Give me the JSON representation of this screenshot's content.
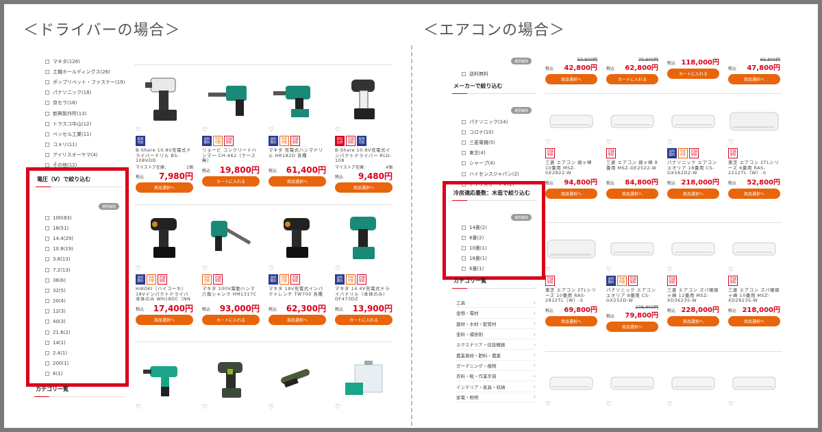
{
  "left": {
    "heading": "＜ドライバーの場合＞",
    "makers": [
      "マキタ(126)",
      "工機ホールディングス(26)",
      "ポップリベット・ファスナー(19)",
      "パナソニック(18)",
      "京セラ(18)",
      "新興製作所(13)",
      "トラスコ中山(12)",
      "ベッセル工業(11)",
      "コメリ(11)",
      "アイリスオーヤマ(4)",
      "その他(12)"
    ],
    "voltage_title": "電圧（V）で絞り込む",
    "clear_label": "選択解除",
    "voltages": [
      "100(83)",
      "18(51)",
      "14.4(29)",
      "10.8(19)",
      "3.6(13)",
      "7.2(13)",
      "36(6)",
      "32(5)",
      "20(4)",
      "12(3)",
      "40(3)",
      "21.6(2)",
      "14(1)",
      "2.4(1)",
      "200(1)",
      "6(1)"
    ],
    "category_title": "カテゴリ一覧",
    "products_row1": [
      {
        "name": "B-Share 10.8V充電式ドライバードリル BS-108VDD",
        "badges": [
          [
            "取寄",
            "可能",
            "blue"
          ]
        ],
        "note": "マイストア在庫：",
        "stock": "1個",
        "tax": "税込",
        "price": "7,980円",
        "button": "商品選択へ"
      },
      {
        "name": "リョービ コンクリートハンマー CH-462（ケース無）",
        "badges": [
          [
            "送料",
            "無料",
            "blue"
          ],
          [
            "宅配",
            "可能",
            "org"
          ],
          [
            "店舗",
            "受取",
            "red"
          ]
        ],
        "tax": "税込",
        "price": "19,800円",
        "button": "カートに入れる"
      },
      {
        "name": "マキタ 充電式ハンマドリル HR182D 各種",
        "badges": [
          [
            "送料",
            "無料",
            "blue"
          ],
          [
            "宅配",
            "可能",
            "org"
          ],
          [
            "店舗",
            "受取",
            "red"
          ]
        ],
        "tax": "税込",
        "price": "61,400円",
        "button": "商品選択へ"
      },
      {
        "name": "B-Share 10.8V充電式インパクトドライバー RLD-108",
        "badges": [
          [
            "即日",
            "出荷",
            "redf"
          ],
          [
            "店舗",
            "受取",
            "red"
          ],
          [
            "取寄",
            "可能",
            "blue"
          ]
        ],
        "note": "マイストア在庫：",
        "stock": "4個",
        "tax": "税込",
        "price": "9,480円",
        "button": "商品選択へ"
      }
    ],
    "products_row2": [
      {
        "name": "HiKOKI（ハイコーキ）18Vインパクトドライバ 本体のみ WH18DC（NN",
        "badges": [
          [
            "送料",
            "無料",
            "blue"
          ],
          [
            "宅配",
            "可能",
            "org"
          ],
          [
            "店舗",
            "受取",
            "red"
          ]
        ],
        "tax": "税込",
        "price": "17,400円",
        "button": "商品選択へ"
      },
      {
        "name": "マキタ 100V電動ハンマ 六角シャンク HM1317C",
        "badges": [
          [
            "宅配",
            "可能",
            "org"
          ],
          [
            "店舗",
            "受取",
            "red"
          ]
        ],
        "tax": "税込",
        "price": "93,000円",
        "button": "カートに入れる"
      },
      {
        "name": "マキタ 18V充電式インパクトレンチ TW700 各種",
        "badges": [
          [
            "送料",
            "無料",
            "blue"
          ],
          [
            "宅配",
            "可能",
            "org"
          ],
          [
            "店舗",
            "受取",
            "red"
          ]
        ],
        "tax": "税込",
        "price": "62,300円",
        "button": "商品選択へ"
      },
      {
        "name": "マキタ 14.4V充電式ドライバドリル（本体のみ） DF473DZ",
        "badges": [
          [
            "送料",
            "無料",
            "blue"
          ],
          [
            "宅配",
            "可能",
            "org"
          ],
          [
            "店舗",
            "受取",
            "red"
          ]
        ],
        "tax": "税込",
        "price": "13,900円",
        "button": "カートに入れる"
      }
    ]
  },
  "right": {
    "heading": "＜エアコンの場合＞",
    "clear_label": "選択解除",
    "shipping_free": "送料無料",
    "maker_title": "メーカーで絞り込む",
    "makers": [
      "パナソニック(14)",
      "コロナ(10)",
      "三菱電機(5)",
      "東芝(4)",
      "シャープ(4)",
      "ハイセンスジャパン(2)",
      "アイリスオーヤマ(2)"
    ],
    "rooms_title": "冷房適応畳数：木造で絞り込む",
    "rooms": [
      "14畳(2)",
      "8畳(2)",
      "10畳(1)",
      "18畳(1)",
      "6畳(1)"
    ],
    "category_title": "カテゴリ一覧",
    "categories": [
      "工具",
      "金物・電材",
      "建材・木材・配管材",
      "塗料・補修剤",
      "エクステリア・住設機器",
      "農業資材・肥料・農薬",
      "ガーデニング・植物",
      "衣料・靴・作業手袋",
      "インテリア・家具・収納",
      "家電・照明"
    ],
    "row0": [
      {
        "tax": "税込",
        "old": "59,800円",
        "price": "42,800円",
        "button": "商品選択へ"
      },
      {
        "tax": "税込",
        "old": "79,800円",
        "price": "62,800円",
        "button": "カートに入れる"
      },
      {
        "tax": "税込",
        "old": "",
        "price": "118,000円",
        "button": "カートに入れる"
      },
      {
        "tax": "税込",
        "old": "69,800円",
        "price": "47,800円",
        "button": "商品選択へ"
      }
    ],
    "row1": [
      {
        "name": "三菱 エアコン 霧ヶ峰 10畳用 MSZ-GE2822-W",
        "badges": [
          [
            "店舗",
            "受取",
            "red"
          ]
        ],
        "tax": "税込",
        "price": "94,800円",
        "button": "商品選択へ"
      },
      {
        "name": "三菱 エアコン 霧ヶ峰 8畳用 MSZ-GE2522-W",
        "badges": [
          [
            "店舗",
            "受取",
            "red"
          ]
        ],
        "tax": "税込",
        "price": "84,800円",
        "button": "商品選択へ"
      },
      {
        "name": "パナソニック エアコン エオリア 18畳用 CS-GX562D2-W",
        "badges": [
          [
            "送料",
            "無料",
            "blue"
          ],
          [
            "宅配",
            "可能",
            "org"
          ],
          [
            "店舗",
            "受取",
            "red"
          ]
        ],
        "tax": "税込",
        "price": "218,000円",
        "button": "商品選択へ"
      },
      {
        "name": "東芝 エアコン 2TLシリーズ 6畳用 RAS-2212TL（W）-S",
        "badges": [
          [
            "店舗",
            "受取",
            "red"
          ]
        ],
        "tax": "税込",
        "price": "52,800円",
        "button": "商品選択へ"
      }
    ],
    "row2": [
      {
        "name": "東芝 エアコン 2TLシリーズ 10畳用 RAS-2812TL（W）-S",
        "badges": [
          [
            "店舗",
            "受取",
            "red"
          ]
        ],
        "tax": "税込",
        "old": "",
        "price": "69,800円",
        "button": "商品選択へ"
      },
      {
        "name": "パナソニック エアコン エオリア 8畳用 CS-GX252D-W",
        "badges": [
          [
            "送料",
            "無料",
            "blue"
          ],
          [
            "宅配",
            "可能",
            "org"
          ],
          [
            "店舗",
            "受取",
            "red"
          ]
        ],
        "tax": "税込",
        "old": "108,800円",
        "price": "79,800円",
        "button": "商品選択へ"
      },
      {
        "name": "三菱 エアコン ズバ暖霧ヶ峰 12畳用 MSZ-XD3623S-W",
        "badges": [
          [
            "店舗",
            "受取",
            "red"
          ]
        ],
        "tax": "税込",
        "old": "",
        "price": "228,000円",
        "button": "商品選択へ"
      },
      {
        "name": "三菱 エアコン ズバ暖霧ヶ峰 10畳用 MSZ-XD2823S-W",
        "badges": [
          [
            "店舗",
            "受取",
            "red"
          ]
        ],
        "tax": "税込",
        "old": "",
        "price": "218,000円",
        "button": "商品選択へ"
      }
    ]
  },
  "colors": {
    "accent_red": "#d9001b",
    "button_orange": "#e8650c",
    "badge_blue": "#2b3a8f"
  }
}
